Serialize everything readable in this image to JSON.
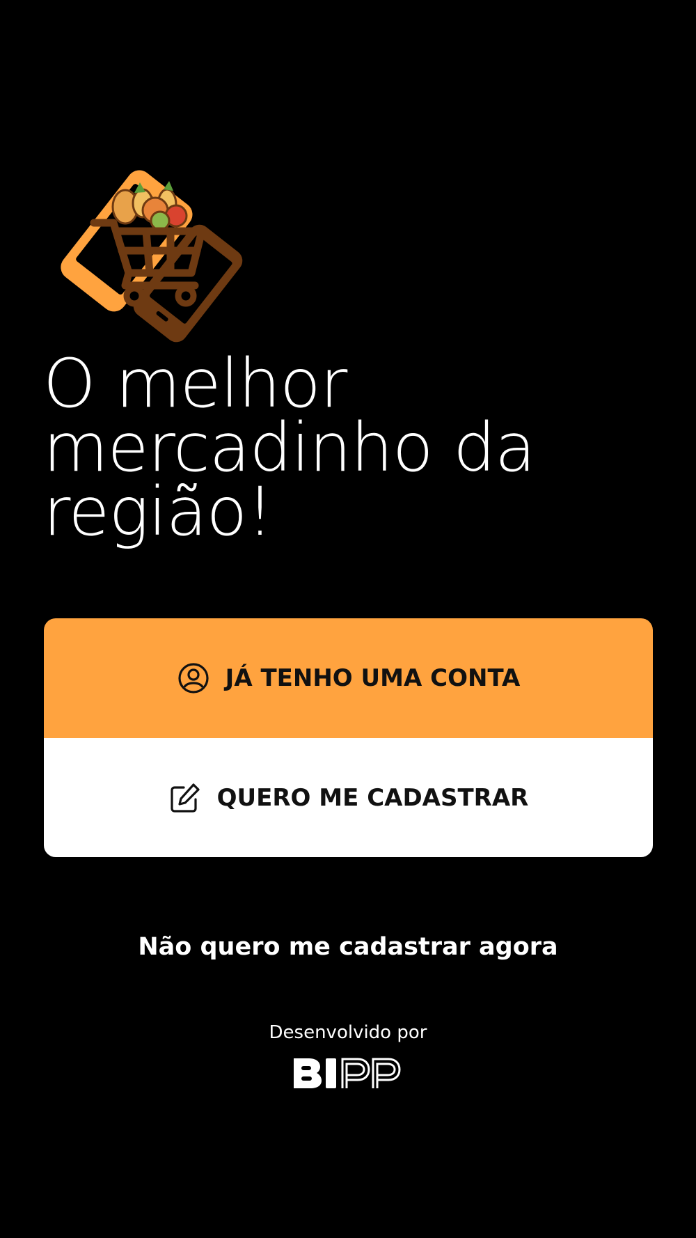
{
  "headline": "O melhor mercadinho da região!",
  "buttons": {
    "login_label": "JÁ TENHO UMA CONTA",
    "login_icon": "user-circle-icon",
    "register_label": "QUERO ME CADASTRAR",
    "register_icon": "edit-icon"
  },
  "skip_label": "Não quero me cadastrar agora",
  "credit_label": "Desenvolvido por",
  "brand_logo_text": "BIPP",
  "colors": {
    "background": "#000000",
    "accent": "#ffa33f",
    "brand_brown": "#6e3a12",
    "text_light": "#ffffff",
    "text_dark": "#111111"
  }
}
